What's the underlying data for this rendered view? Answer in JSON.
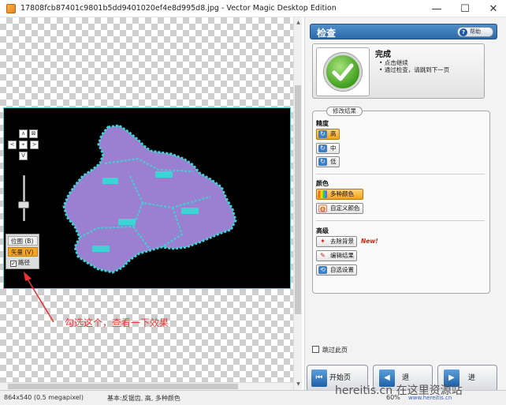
{
  "window": {
    "title": "17808fcb87401c9801b5dd9401020ef4e8d995d8.jpg - Vector Magic Desktop Edition",
    "minimize": "—",
    "maximize": "☐",
    "close": "✕"
  },
  "canvas": {
    "nav": {
      "up": "∧",
      "down": "V",
      "left": "<",
      "right": ">",
      "center": "⌖",
      "fit": "⊠"
    },
    "view_modes": {
      "bitmap": "位图 (B)",
      "vector": "矢量 (V)",
      "path": "路径",
      "path_checked": "✓"
    },
    "annotation": "勾选这个，查看一下效果"
  },
  "panel": {
    "title": "检查",
    "help": "帮助",
    "help_icon": "?",
    "status": {
      "title": "完成",
      "lines": [
        "• 点击继续",
        "• 通过检查，请跳到下一页"
      ]
    },
    "modify": {
      "tab": "修改结果",
      "precision": {
        "title": "精度",
        "high": "高",
        "medium": "中",
        "low": "低"
      },
      "colors": {
        "title": "颜色",
        "multi": "多种颜色",
        "custom": "自定义颜色"
      },
      "advanced": {
        "title": "高级",
        "remove_bg": "去除背景",
        "new": "New!",
        "edit_result": "编辑结果",
        "auto_settings": "自选设置"
      }
    },
    "skip": "跳过此页",
    "buttons": {
      "start": "开始页",
      "back": "退",
      "next": "进"
    }
  },
  "statusbar": {
    "size": "864x540 (0.5 megapixel)",
    "basic": "基本:反锯齿, 高, 多种颜色",
    "zoom": "60%",
    "url": "www.hereitis.cn",
    "watermark": "hereitis.cn 在这里资源站"
  },
  "colors": {
    "accent": "#2c6aa7",
    "selected": "#f5a215",
    "map_fill": "#9b7fd0",
    "map_edge": "#3cd4d4",
    "annotation": "#ee3333"
  }
}
